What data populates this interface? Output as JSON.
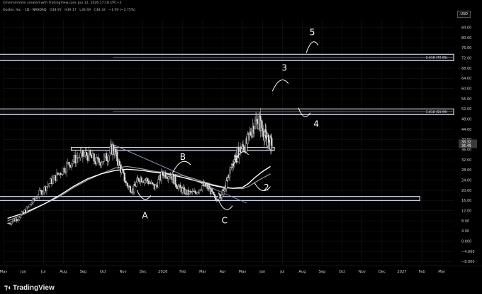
{
  "header": {
    "line1": "Cmmmmmmn created with TradingView.com, Jun 12, 2026 17:18 UTC+3",
    "symbol": "Ouster, Inc. · 1D · NASDAQ",
    "open": "O38.91",
    "high": "H39.17",
    "low": "L36.49",
    "close": "C38.32",
    "change": "−1.09 (−2.75%)"
  },
  "currency": "USD",
  "brand": {
    "icon": "tradingview-logo-icon",
    "name": "TradingView"
  },
  "colors": {
    "candle": "#d9d9d9",
    "zone_border": "#cfd3e6",
    "ma_fast": "#9a9a9a",
    "ma_slow": "#ffffff",
    "annotation": "#ffffff",
    "price_label_bg": "#3a3a3a"
  },
  "chart_data": {
    "type": "candlestick",
    "y_axis": {
      "labels": [
        "84.00",
        "80.00",
        "76.00",
        "72.00",
        "68.00",
        "64.00",
        "60.00",
        "56.00",
        "52.00",
        "48.00",
        "44.00",
        "40.00",
        "36.00",
        "32.00",
        "28.00",
        "24.00",
        "20.00",
        "16.00",
        "12.00",
        "8.00",
        "4.00",
        "0.000",
        "−4.000",
        "−8.000"
      ],
      "range": [
        -9,
        87
      ]
    },
    "x_axis": {
      "labels": [
        "May",
        "Jun",
        "Jul",
        "Aug",
        "Sep",
        "Oct",
        "Nov",
        "Dec",
        "2026",
        "Feb",
        "Mar",
        "Apr",
        "May",
        "Jun",
        "Jul",
        "Aug",
        "Sep",
        "Oct",
        "Nov",
        "Dec",
        "2027",
        "Feb",
        "Mar"
      ],
      "range": [
        0,
        22.6
      ]
    },
    "current_price": {
      "value": 38.32,
      "labels": [
        "38.32",
        "36.49"
      ]
    },
    "zones": [
      {
        "label": "2.618 (72.05)",
        "y": [
          71,
          73.5
        ],
        "x_start": -0.5,
        "label_x": 21.2
      },
      {
        "label": "1.618 (50.99)",
        "y": [
          49.8,
          52
        ],
        "x_start": -0.5,
        "label_x": 21.2
      },
      {
        "label": "",
        "y": [
          35.7,
          36.9
        ],
        "x_start": 3.4,
        "x_end": 13.6
      },
      {
        "label": "",
        "y": [
          16,
          17.6
        ],
        "x_start": -0.5,
        "x_end": 20.9
      }
    ],
    "trendline": {
      "x": [
        5.5,
        12.2
      ],
      "y": [
        38,
        15
      ]
    },
    "ma_fast": {
      "x": [
        0.2,
        1,
        2,
        2.8,
        3.5,
        4.2,
        4.9,
        5.6,
        6.2,
        7,
        7.5,
        8,
        8.5,
        9,
        9.5,
        10,
        10.5,
        11,
        11.5,
        12,
        12.3,
        12.6,
        13,
        13.4
      ],
      "y": [
        8,
        10.5,
        14.5,
        17.5,
        21,
        24,
        26.5,
        28.8,
        29.4,
        28.4,
        27.6,
        27,
        26.4,
        25.8,
        24.8,
        23.4,
        22.3,
        21.4,
        20.8,
        20.7,
        21.5,
        23,
        24.8,
        26.5
      ]
    },
    "ma_slow": {
      "x": [
        0.2,
        1,
        2,
        2.8,
        3.5,
        4.2,
        4.9,
        5.6,
        6.2,
        7,
        7.5,
        8,
        8.5,
        9,
        9.5,
        10,
        10.5,
        11,
        11.5,
        12,
        12.3,
        12.6,
        13,
        13.4
      ],
      "y": [
        9,
        11,
        14.5,
        18,
        21.5,
        24.5,
        26.5,
        27.8,
        28.3,
        27.8,
        27.2,
        26.8,
        26,
        25.1,
        24.1,
        23,
        22,
        21.2,
        20.8,
        21.2,
        22.7,
        24.9,
        27.4,
        29.4
      ]
    },
    "candles": {
      "x": [
        0.2,
        0.7,
        1.2,
        1.7,
        2.2,
        2.7,
        3.2,
        3.7,
        4.2,
        4.7,
        5.2,
        5.5,
        5.8,
        6.2,
        6.5,
        6.8,
        7.2,
        7.6,
        8,
        8.4,
        8.8,
        9.2,
        9.6,
        10,
        10.3,
        10.6,
        10.9,
        11.1,
        11.3,
        11.6,
        11.9,
        12.2,
        12.5,
        12.8,
        13.1,
        13.3,
        13.5
      ],
      "y": [
        7,
        9,
        13,
        18,
        22,
        26,
        30,
        33,
        34,
        31,
        33,
        37,
        30,
        22,
        20,
        25,
        24,
        21,
        27,
        26,
        21,
        19,
        19,
        22,
        21,
        17,
        18,
        20,
        26,
        33,
        36,
        38,
        45,
        48,
        42,
        39,
        38
      ]
    },
    "annotations": [
      {
        "text": "A",
        "x": 7.1,
        "y": 9
      },
      {
        "text": "B",
        "x": 9.0,
        "y": 32
      },
      {
        "text": "C",
        "x": 11.1,
        "y": 7
      },
      {
        "text": "1",
        "x": 11.7,
        "y": 31
      },
      {
        "text": "2",
        "x": 13.2,
        "y": 20
      },
      {
        "text": "3",
        "x": 14.1,
        "y": 67
      },
      {
        "text": "4",
        "x": 15.7,
        "y": 45
      },
      {
        "text": "5",
        "x": 15.5,
        "y": 81
      }
    ],
    "arcs": [
      {
        "shape": "smile",
        "x": [
          6.7,
          7.4
        ],
        "y": [
          20,
          18
        ]
      },
      {
        "shape": "cap",
        "x": [
          8.5,
          9.4
        ],
        "y": [
          27,
          30
        ]
      },
      {
        "shape": "smile",
        "x": [
          10.8,
          11.5
        ],
        "y": [
          16,
          14
        ]
      },
      {
        "shape": "cap",
        "x": [
          11.5,
          12.3
        ],
        "y": [
          29,
          34
        ]
      },
      {
        "shape": "smile",
        "x": [
          12.6,
          13.4
        ],
        "y": [
          23,
          21.5
        ]
      },
      {
        "shape": "cap",
        "x": [
          13.5,
          14.3
        ],
        "y": [
          59,
          62
        ]
      },
      {
        "shape": "smile",
        "x": [
          14.8,
          15.4
        ],
        "y": [
          52.5,
          50.5
        ]
      },
      {
        "shape": "cap",
        "x": [
          15.2,
          15.8
        ],
        "y": [
          74,
          77
        ]
      }
    ]
  }
}
